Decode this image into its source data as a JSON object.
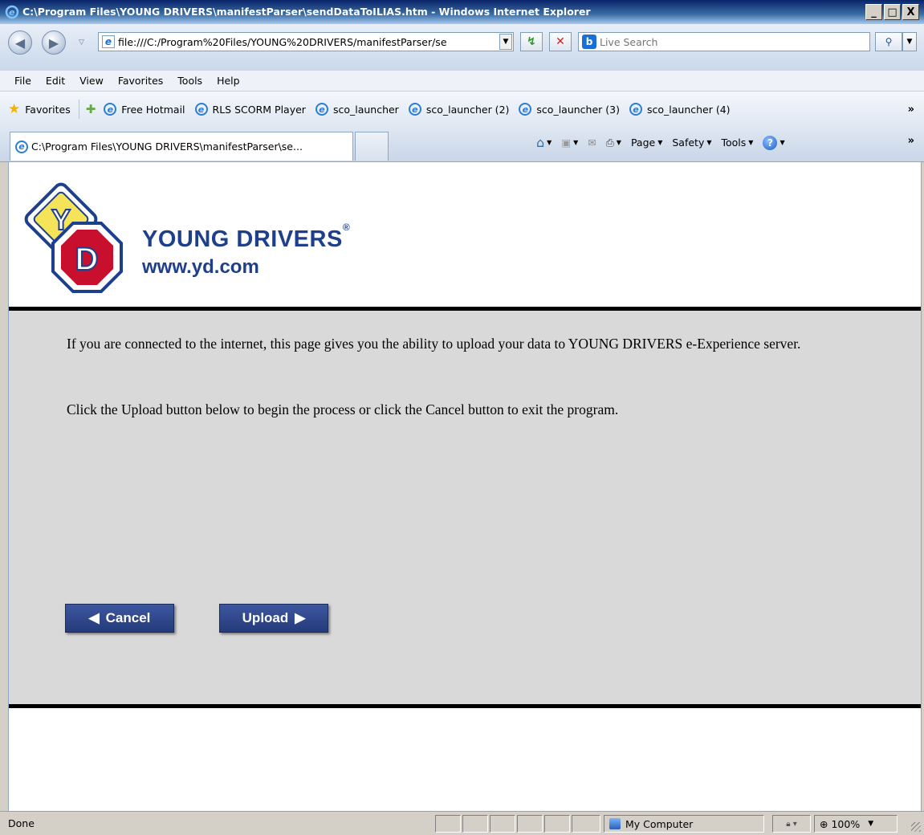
{
  "window": {
    "title": "C:\\Program Files\\YOUNG DRIVERS\\manifestParser\\sendDataToILIAS.htm - Windows Internet Explorer",
    "minimize": "_",
    "maximize": "□",
    "close": "X"
  },
  "address": {
    "url": "file:///C:/Program%20Files/YOUNG%20DRIVERS/manifestParser/se",
    "search_placeholder": "Live Search"
  },
  "menu": [
    "File",
    "Edit",
    "View",
    "Favorites",
    "Tools",
    "Help"
  ],
  "favorites": {
    "label": "Favorites",
    "links": [
      "Free Hotmail",
      "RLS SCORM Player",
      "sco_launcher",
      "sco_launcher (2)",
      "sco_launcher (3)",
      "sco_launcher (4)"
    ]
  },
  "tab": {
    "title": "C:\\Program Files\\YOUNG DRIVERS\\manifestParser\\se..."
  },
  "commands": [
    "Page",
    "Safety",
    "Tools"
  ],
  "page": {
    "brand_name": "YOUNG DRIVERS",
    "brand_reg": "®",
    "brand_web": "www.yd.com",
    "paragraph1": "If you are connected to the internet, this page gives you the ability to upload your data to YOUNG DRIVERS e-Experience server.",
    "paragraph2": "Click the Upload button below to begin the process or click the Cancel button to exit the program.",
    "cancel_label": "Cancel",
    "upload_label": "Upload"
  },
  "status": {
    "text": "Done",
    "zone": "My Computer",
    "zoom": "100%"
  },
  "colors": {
    "brand_blue": "#1e3f8c",
    "button_blue": "#2f4a8f",
    "panel_gray": "#d9d9d9"
  }
}
